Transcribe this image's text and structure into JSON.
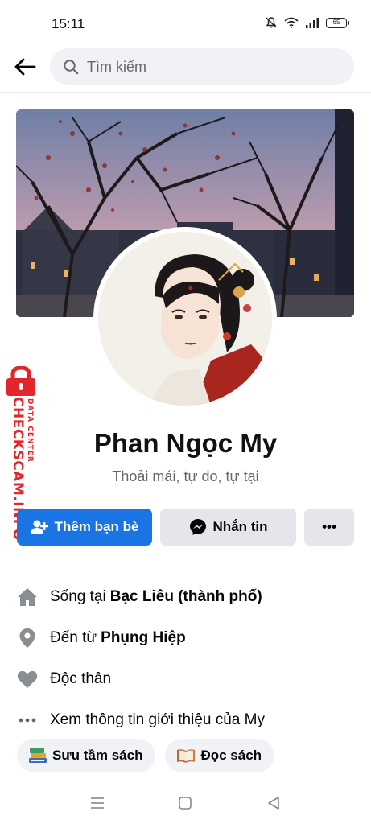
{
  "status_bar": {
    "time": "15:11",
    "battery": "65"
  },
  "search": {
    "placeholder": "Tìm kiếm"
  },
  "profile": {
    "name": "Phan Ngọc My",
    "bio": "Thoải mái, tự do, tự tại"
  },
  "actions": {
    "add_friend": "Thêm bạn bè",
    "message": "Nhắn tin",
    "more": "•••"
  },
  "intro": {
    "lives_prefix": "Sống tại",
    "lives_value": "Bạc Liêu (thành phố)",
    "from_prefix": "Đến từ",
    "from_value": "Phụng Hiệp",
    "relationship": "Độc thân",
    "see_about": "Xem thông tin giới thiệu của My"
  },
  "hobbies": [
    {
      "icon": "books-icon",
      "label": "Sưu tầm sách"
    },
    {
      "icon": "open-book-icon",
      "label": "Đọc sách"
    }
  ],
  "watermark": {
    "main": "CHECKSCAM.INFO",
    "sub": "DATA CENTER"
  },
  "colors": {
    "primary": "#1b74e4",
    "secondary_button": "#e4e6eb",
    "watermark": "#e3262b"
  }
}
